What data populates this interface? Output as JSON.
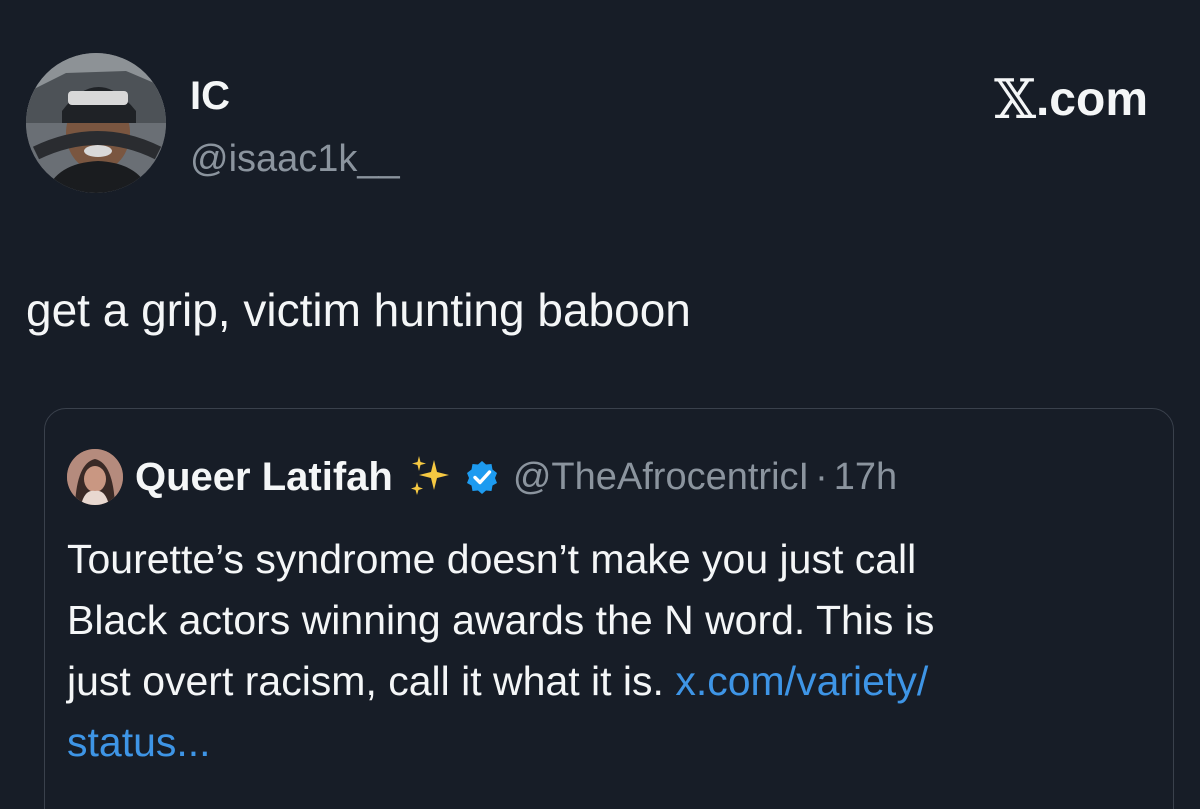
{
  "brand": {
    "logo_glyph": "𝕏",
    "label": ".com"
  },
  "author": {
    "name": "IC",
    "handle": "@isaac1k__"
  },
  "tweet": {
    "text": "get a grip, victim hunting baboon"
  },
  "quote": {
    "name": "Queer Latifah",
    "sparkle_icon": "sparkles-emoji",
    "verified_icon": "verified-badge-icon",
    "handle": "@TheAfrocentricI",
    "separator": "·",
    "time": "17h",
    "line1": "Tourette’s syndrome doesn’t make you just call",
    "line2": "Black actors winning awards the N word. This is",
    "line3_text": "just overt racism, call it what it is. ",
    "line3_link": "x.com/variety/",
    "line4_link": "status..."
  },
  "colors": {
    "background": "#171d27",
    "text": "#f4f6f7",
    "secondary_text": "#8b949e",
    "link": "#3e95e6",
    "verified": "#1d9bf0",
    "sparkle": "#f5c842",
    "quote_border": "#3a414c"
  }
}
